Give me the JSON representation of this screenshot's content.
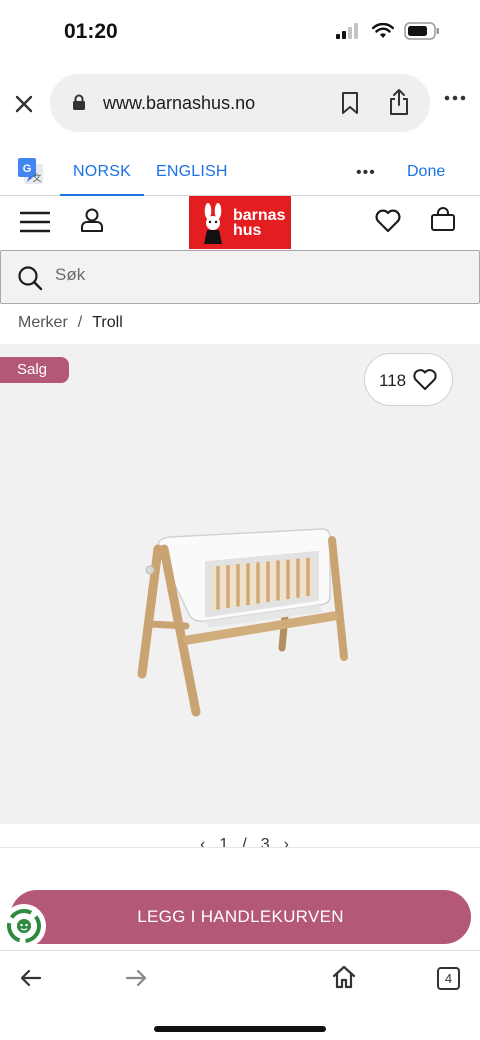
{
  "status": {
    "time": "01:20"
  },
  "browser": {
    "url": "www.barnashus.no",
    "tabs_count": "4"
  },
  "translate": {
    "languages": [
      "NORSK",
      "ENGLISH"
    ],
    "active": "NORSK",
    "more": "•••",
    "done": "Done"
  },
  "site": {
    "logo_line1": "barnas",
    "logo_line2": "hus",
    "search_placeholder": "Søk",
    "brand_color": "#e41e20"
  },
  "breadcrumb": {
    "items": [
      "Merker",
      "Troll"
    ],
    "separator": "/"
  },
  "product": {
    "sale_badge": "Salg",
    "wishlist_count": "118",
    "pager": {
      "current": "1",
      "separator": "/",
      "total": "3"
    },
    "add_to_cart": "LEGG I HANDLEKURVEN",
    "accent_color": "#b4587a"
  }
}
